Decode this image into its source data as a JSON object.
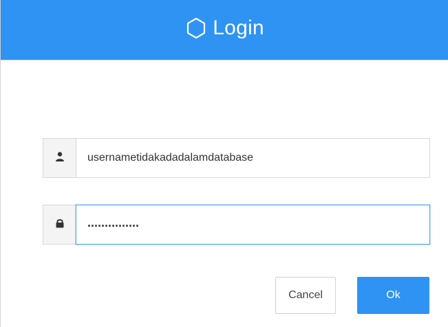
{
  "window": {
    "title": "Login"
  },
  "form": {
    "username": {
      "value": "usernametidakadadalamdatabase",
      "icon": "user-icon"
    },
    "password": {
      "masked_value": "...............",
      "icon": "lock-icon"
    }
  },
  "buttons": {
    "cancel_label": "Cancel",
    "ok_label": "Ok"
  },
  "colors": {
    "primary": "#2e93f2",
    "focus_border": "#5aa6ee"
  }
}
